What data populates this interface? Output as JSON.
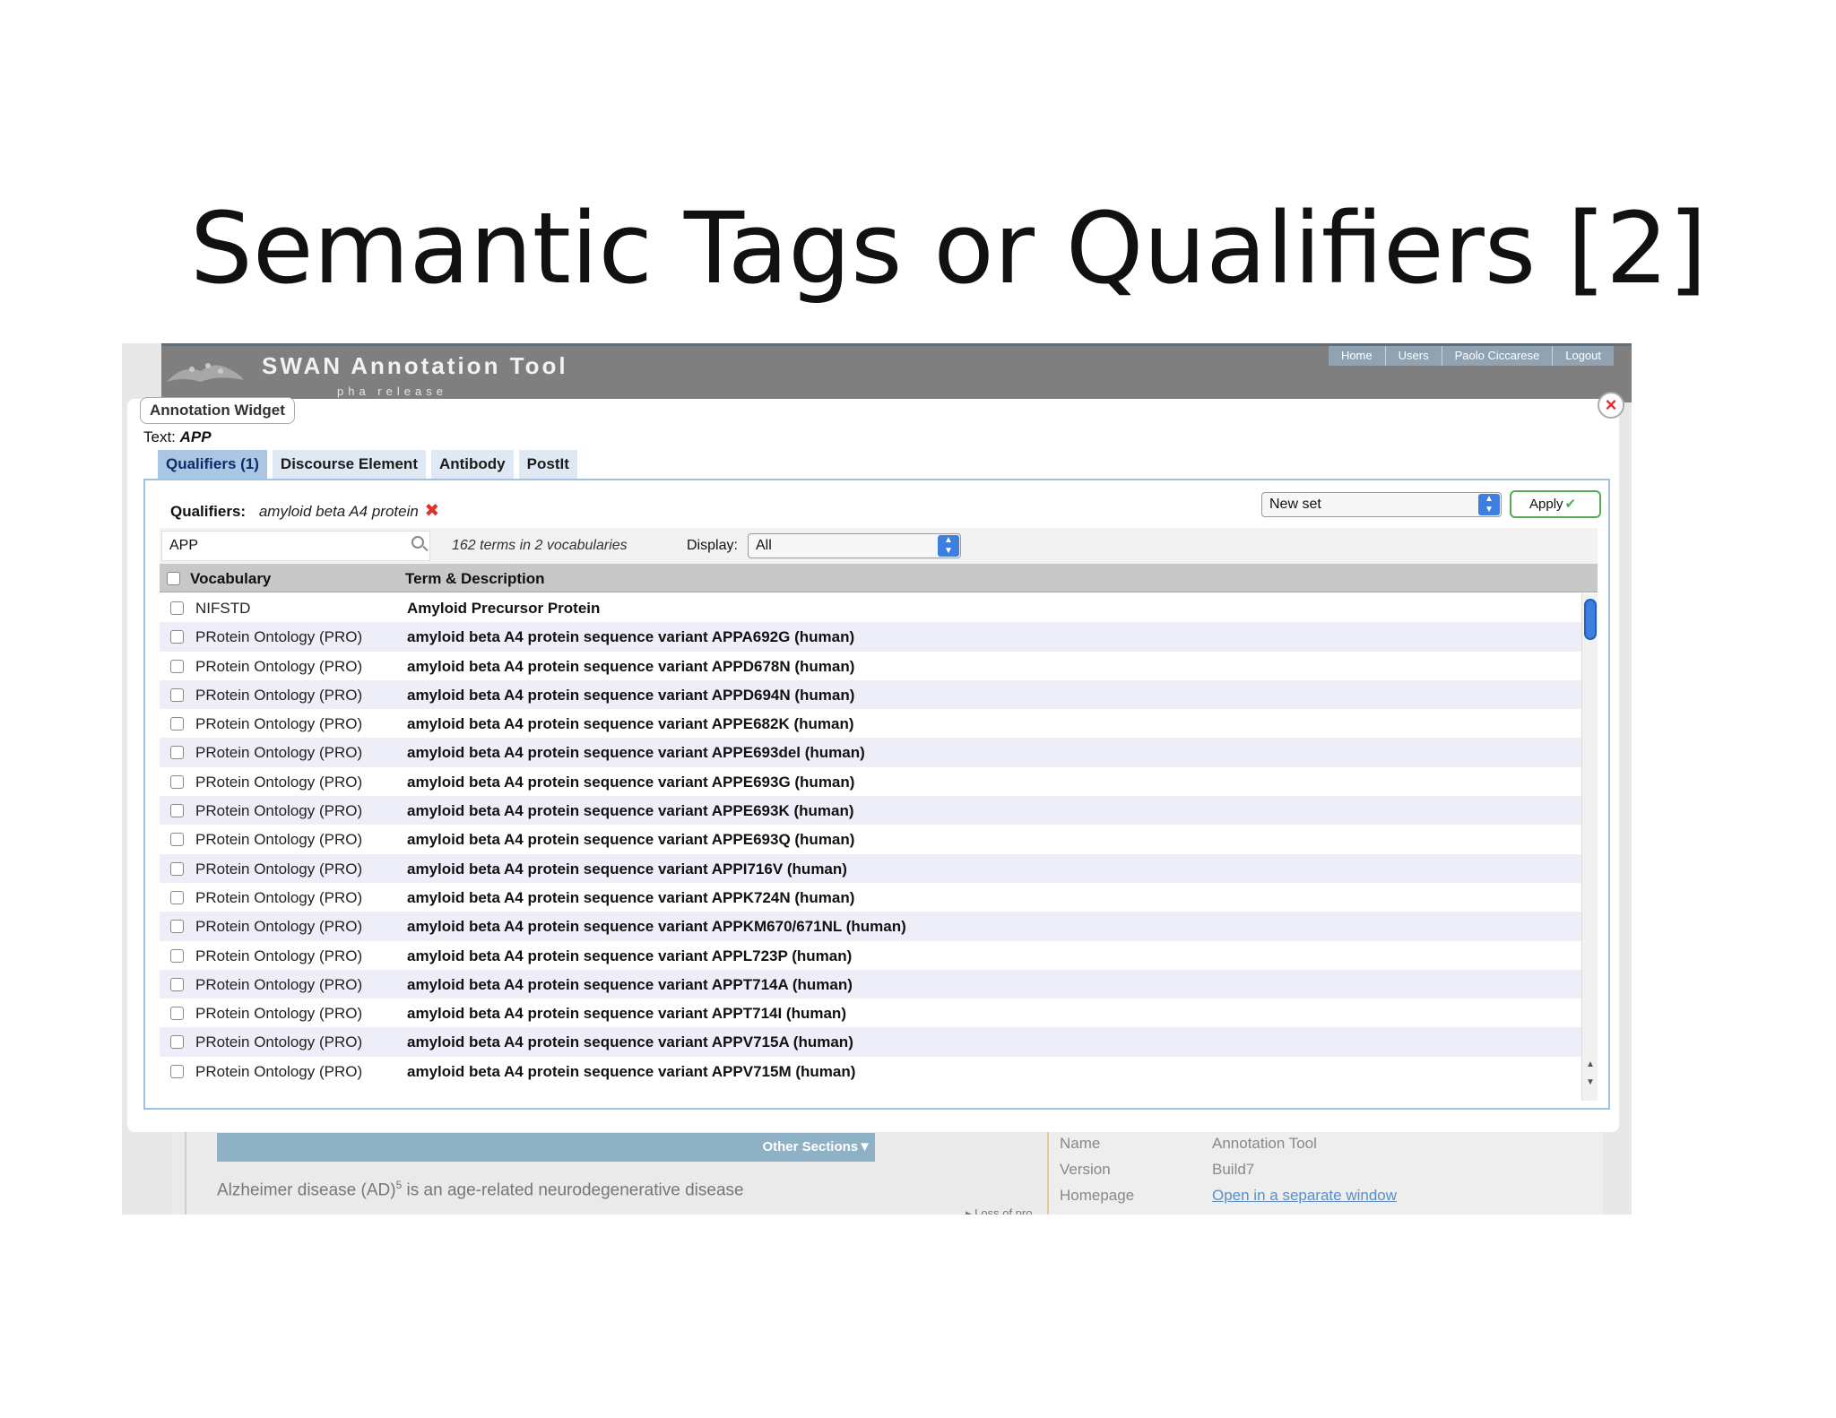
{
  "slide": {
    "title": "Semantic Tags or Qualifiers [2]"
  },
  "app": {
    "title": "SWAN Annotation Tool",
    "subtitle": "pha release",
    "nav": [
      "Home",
      "Users",
      "Paolo Ciccarese",
      "Logout"
    ]
  },
  "widget": {
    "title": "Annotation Widget",
    "close_icon": "×",
    "text_label": "Text:",
    "text_value": "APP",
    "tabs": [
      "Qualifiers (1)",
      "Discourse Element",
      "Antibody",
      "PostIt"
    ],
    "qualifiers_label": "Qualifiers:",
    "qualifiers_value": "amyloid beta A4 protein",
    "remove_icon": "✖",
    "set_select": "New set",
    "apply_label": "Apply",
    "apply_icon": "✔",
    "search_value": "APP",
    "term_count": "162 terms in 2 vocabularies",
    "display_label": "Display:",
    "display_value": "All",
    "headers": {
      "vocabulary": "Vocabulary",
      "term": "Term & Description"
    },
    "rows": [
      {
        "vocab": "NIFSTD",
        "term": "Amyloid Precursor Protein"
      },
      {
        "vocab": "PRotein Ontology (PRO)",
        "term": "amyloid beta A4 protein sequence variant APPA692G (human)"
      },
      {
        "vocab": "PRotein Ontology (PRO)",
        "term": "amyloid beta A4 protein sequence variant APPD678N (human)"
      },
      {
        "vocab": "PRotein Ontology (PRO)",
        "term": "amyloid beta A4 protein sequence variant APPD694N (human)"
      },
      {
        "vocab": "PRotein Ontology (PRO)",
        "term": "amyloid beta A4 protein sequence variant APPE682K (human)"
      },
      {
        "vocab": "PRotein Ontology (PRO)",
        "term": "amyloid beta A4 protein sequence variant APPE693del (human)"
      },
      {
        "vocab": "PRotein Ontology (PRO)",
        "term": "amyloid beta A4 protein sequence variant APPE693G (human)"
      },
      {
        "vocab": "PRotein Ontology (PRO)",
        "term": "amyloid beta A4 protein sequence variant APPE693K (human)"
      },
      {
        "vocab": "PRotein Ontology (PRO)",
        "term": "amyloid beta A4 protein sequence variant APPE693Q (human)"
      },
      {
        "vocab": "PRotein Ontology (PRO)",
        "term": "amyloid beta A4 protein sequence variant APPI716V (human)"
      },
      {
        "vocab": "PRotein Ontology (PRO)",
        "term": "amyloid beta A4 protein sequence variant APPK724N (human)"
      },
      {
        "vocab": "PRotein Ontology (PRO)",
        "term": "amyloid beta A4 protein sequence variant APPKM670/671NL (human)"
      },
      {
        "vocab": "PRotein Ontology (PRO)",
        "term": "amyloid beta A4 protein sequence variant APPL723P (human)"
      },
      {
        "vocab": "PRotein Ontology (PRO)",
        "term": "amyloid beta A4 protein sequence variant APPT714A (human)"
      },
      {
        "vocab": "PRotein Ontology (PRO)",
        "term": "amyloid beta A4 protein sequence variant APPT714I (human)"
      },
      {
        "vocab": "PRotein Ontology (PRO)",
        "term": "amyloid beta A4 protein sequence variant APPV715A (human)"
      },
      {
        "vocab": "PRotein Ontology (PRO)",
        "term": "amyloid beta A4 protein sequence variant APPV715M (human)"
      }
    ]
  },
  "background": {
    "other_sections": "Other Sections▼",
    "paragraph_start": "Alzheimer disease (AD)",
    "paragraph_sup": "5",
    "paragraph_end": " is an age-related neurodegenerative disease",
    "truncated": "▸ Loss of pro",
    "info": [
      {
        "label": "Name",
        "value": "Annotation Tool"
      },
      {
        "label": "Version",
        "value": "Build7"
      },
      {
        "label": "Homepage",
        "value": "Open in a separate window"
      }
    ]
  },
  "colors": {
    "tab_active": "#a9c6e4",
    "panel_border": "#9ec3e5",
    "scroll_thumb": "#3d7fe0",
    "close_x": "#e03030",
    "apply_border": "#55aa55"
  }
}
